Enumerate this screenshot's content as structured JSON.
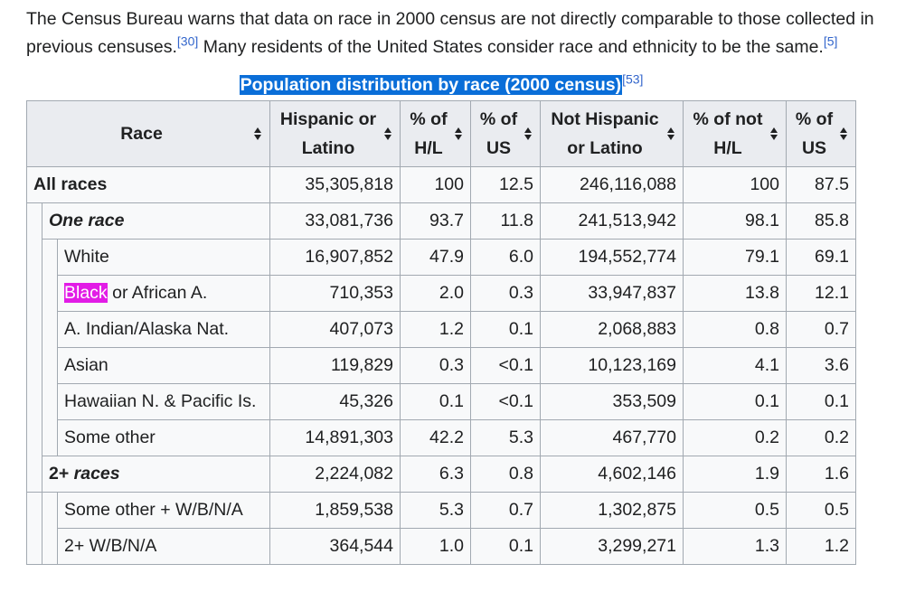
{
  "paragraph": {
    "text_1": "The Census Bureau warns that data on race in 2000 census are not directly comparable to those collected in previous censuses.",
    "ref_1": "[30]",
    "text_2": " Many residents of the United States consider race and ethnicity to be the same.",
    "ref_2": "[5]"
  },
  "table": {
    "caption": "Population distribution by race (2000 census)",
    "caption_ref": "[53]",
    "headers": [
      {
        "line1": "Race",
        "line2": ""
      },
      {
        "line1": "Hispanic or",
        "line2": "Latino"
      },
      {
        "line1": "% of",
        "line2": "H/L"
      },
      {
        "line1": "% of",
        "line2": "US"
      },
      {
        "line1": "Not Hispanic",
        "line2": "or Latino"
      },
      {
        "line1": "% of not",
        "line2": "H/L"
      },
      {
        "line1": "% of",
        "line2": "US"
      }
    ],
    "rows": [
      {
        "race": "All races",
        "hl": "35,305,818",
        "pct_hl": "100",
        "pct_us_hl": "12.5",
        "nhl": "246,116,088",
        "pct_nhl": "100",
        "pct_us_nhl": "87.5"
      },
      {
        "race": "One race",
        "hl": "33,081,736",
        "pct_hl": "93.7",
        "pct_us_hl": "11.8",
        "nhl": "241,513,942",
        "pct_nhl": "98.1",
        "pct_us_nhl": "85.8"
      },
      {
        "race": "White",
        "hl": "16,907,852",
        "pct_hl": "47.9",
        "pct_us_hl": "6.0",
        "nhl": "194,552,774",
        "pct_nhl": "79.1",
        "pct_us_nhl": "69.1"
      },
      {
        "race_highlight": "Black",
        "race_rest": " or African A.",
        "hl": "710,353",
        "pct_hl": "2.0",
        "pct_us_hl": "0.3",
        "nhl": "33,947,837",
        "pct_nhl": "13.8",
        "pct_us_nhl": "12.1"
      },
      {
        "race": "A. Indian/Alaska Nat.",
        "hl": "407,073",
        "pct_hl": "1.2",
        "pct_us_hl": "0.1",
        "nhl": "2,068,883",
        "pct_nhl": "0.8",
        "pct_us_nhl": "0.7"
      },
      {
        "race": "Asian",
        "hl": "119,829",
        "pct_hl": "0.3",
        "pct_us_hl": "<0.1",
        "nhl": "10,123,169",
        "pct_nhl": "4.1",
        "pct_us_nhl": "3.6"
      },
      {
        "race": "Hawaiian N. & Pacific Is.",
        "hl": "45,326",
        "pct_hl": "0.1",
        "pct_us_hl": "<0.1",
        "nhl": "353,509",
        "pct_nhl": "0.1",
        "pct_us_nhl": "0.1"
      },
      {
        "race": "Some other",
        "hl": "14,891,303",
        "pct_hl": "42.2",
        "pct_us_hl": "5.3",
        "nhl": "467,770",
        "pct_nhl": "0.2",
        "pct_us_nhl": "0.2"
      },
      {
        "race_prefix": "2+",
        "race_rest": " races",
        "hl": "2,224,082",
        "pct_hl": "6.3",
        "pct_us_hl": "0.8",
        "nhl": "4,602,146",
        "pct_nhl": "1.9",
        "pct_us_nhl": "1.6"
      },
      {
        "race": "Some other + W/B/N/A",
        "hl": "1,859,538",
        "pct_hl": "5.3",
        "pct_us_hl": "0.7",
        "nhl": "1,302,875",
        "pct_nhl": "0.5",
        "pct_us_nhl": "0.5"
      },
      {
        "race": "2+ W/B/N/A",
        "hl": "364,544",
        "pct_hl": "1.0",
        "pct_us_hl": "0.1",
        "nhl": "3,299,271",
        "pct_nhl": "1.3",
        "pct_us_nhl": "1.2"
      }
    ]
  },
  "colors": {
    "caption_selection": "#0a6ed8",
    "search_highlight": "#e21ce6",
    "link": "#3366cc",
    "header_bg": "#eaecf0",
    "cell_bg": "#f8f9fa",
    "border": "#a2a9b1",
    "text": "#202122"
  }
}
